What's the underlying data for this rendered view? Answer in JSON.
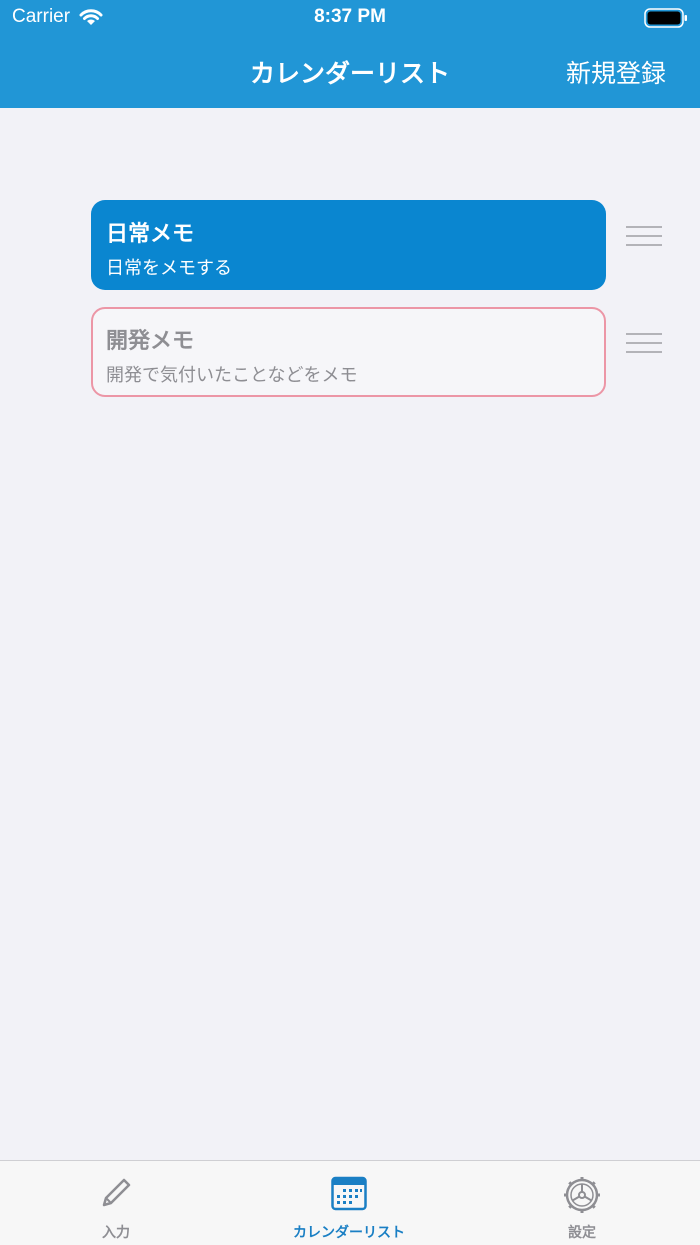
{
  "status_bar": {
    "carrier": "Carrier",
    "time": "8:37 PM"
  },
  "nav": {
    "title": "カレンダーリスト",
    "action": "新規登録"
  },
  "calendars": [
    {
      "title": "日常メモ",
      "subtitle": "日常をメモする",
      "state": "selected",
      "color": "#0a86d0"
    },
    {
      "title": "開発メモ",
      "subtitle": "開発で気付いたことなどをメモ",
      "state": "unselected",
      "color": "#ec96a6"
    }
  ],
  "tabbar": {
    "tabs": [
      {
        "label": "入力",
        "icon": "pencil-icon",
        "selected": false
      },
      {
        "label": "カレンダーリスト",
        "icon": "calendar-icon",
        "selected": true
      },
      {
        "label": "設定",
        "icon": "gear-icon",
        "selected": false
      }
    ]
  },
  "colors": {
    "accent": "#2196d6",
    "selected_tab": "#1a7fc4",
    "background": "#f2f2f7"
  }
}
